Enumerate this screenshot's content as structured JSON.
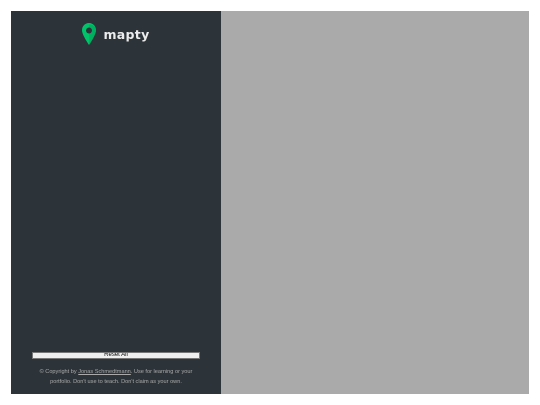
{
  "sidebar": {
    "logo": {
      "text": "mapty",
      "icon": "map-pin-icon",
      "icon_color": "#00c46a"
    },
    "reset_button": {
      "label": "Reset All"
    },
    "copyright": {
      "prefix": "© Copyright by ",
      "author_link": "Jonas Schmedtmann",
      "suffix": ". Use for learning or your portfolio. Don't use to teach. Don't claim as your own."
    }
  },
  "colors": {
    "sidebar_bg": "#2d3439",
    "map_bg": "#aaaaaa",
    "brand_green": "#00c46a",
    "text_muted": "#aaaaaa"
  }
}
